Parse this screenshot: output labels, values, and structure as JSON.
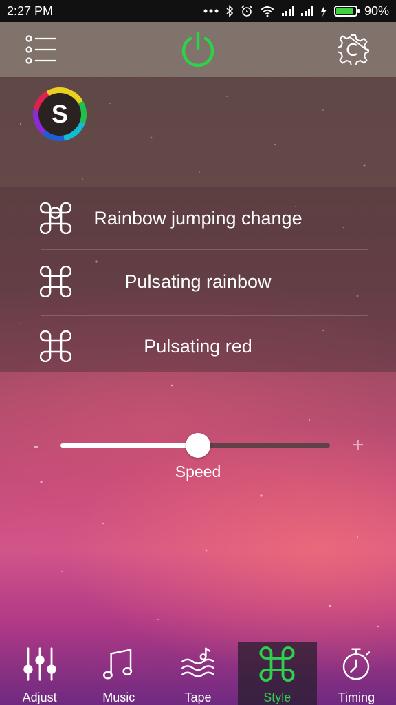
{
  "status_bar": {
    "time": "2:27 PM",
    "battery": "90%",
    "battery_level": 0.9,
    "icons": [
      "more-dots-icon",
      "bluetooth-icon",
      "alarm-icon",
      "wifi-icon",
      "signal-icon",
      "signal-icon",
      "charging-icon",
      "battery-icon"
    ]
  },
  "header": {
    "menu_icon": "list-menu-icon",
    "power_icon": "power-icon",
    "power_color": "#2bd24a",
    "settings_icon": "gear-icon"
  },
  "mode": {
    "letter": "S",
    "icon": "rainbow-ring-icon"
  },
  "effects": [
    {
      "label": "Rainbow jumping change",
      "icon": "command-key-icon"
    },
    {
      "label": "Pulsating rainbow",
      "icon": "command-key-icon"
    },
    {
      "label": "Pulsating red",
      "icon": "command-key-icon"
    }
  ],
  "speed": {
    "label": "Speed",
    "minus": "-",
    "plus": "+",
    "level": 0.51
  },
  "nav": {
    "active_color": "#2fcf4f",
    "items": [
      {
        "label": "Adjust",
        "icon": "equalizer-sliders-icon"
      },
      {
        "label": "Music",
        "icon": "music-note-icon"
      },
      {
        "label": "Tape",
        "icon": "tape-wave-icon"
      },
      {
        "label": "Style",
        "icon": "command-key-icon",
        "active": true
      },
      {
        "label": "Timing",
        "icon": "stopwatch-icon"
      }
    ]
  }
}
